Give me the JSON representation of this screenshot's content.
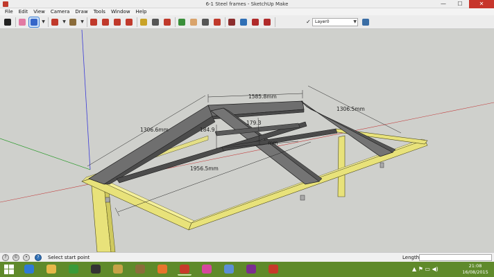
{
  "window": {
    "title": "6-1 Steel frames - SketchUp Make",
    "minimize": "—",
    "maximize": "☐",
    "close": "✕"
  },
  "menu": [
    "File",
    "Edit",
    "View",
    "Camera",
    "Draw",
    "Tools",
    "Window",
    "Help"
  ],
  "toolbar": {
    "layer_selected": "Layer0",
    "layer_check": "✓",
    "tools": [
      {
        "name": "select-tool-button",
        "icon": "arrow-pointer-icon",
        "color": "#222222"
      },
      {
        "name": "eraser-tool-button",
        "icon": "eraser-icon",
        "color": "#e27aa3"
      },
      {
        "name": "pencil-tool-button",
        "icon": "pencil-icon",
        "color": "#3566c9",
        "active": true
      },
      {
        "name": "pencil-dropdown-button",
        "icon": "chevron-down-icon",
        "color": "#333333"
      },
      {
        "name": "arc-tool-button",
        "icon": "arc-icon",
        "color": "#c0392b"
      },
      {
        "name": "arc-dropdown-button",
        "icon": "chevron-down-icon",
        "color": "#333333"
      },
      {
        "name": "paint-bucket-button",
        "icon": "paint-bucket-icon",
        "color": "#8a6b3a"
      },
      {
        "name": "paint-dropdown-button",
        "icon": "chevron-down-icon",
        "color": "#333333"
      },
      {
        "name": "push-pull-button",
        "icon": "push-pull-icon",
        "color": "#c0392b"
      },
      {
        "name": "move-tool-button",
        "icon": "move-icon",
        "color": "#c0392b"
      },
      {
        "name": "rotate-tool-button",
        "icon": "rotate-icon",
        "color": "#c0392b"
      },
      {
        "name": "scale-tool-button",
        "icon": "scale-icon",
        "color": "#c0392b"
      },
      {
        "name": "tape-measure-button",
        "icon": "tape-measure-icon",
        "color": "#c9a227"
      },
      {
        "name": "text-tool-button",
        "icon": "text-icon",
        "color": "#555555"
      },
      {
        "name": "axes-tool-button",
        "icon": "axes-icon",
        "color": "#c0392b"
      },
      {
        "name": "orbit-tool-button",
        "icon": "orbit-icon",
        "color": "#3a8f3a"
      },
      {
        "name": "pan-tool-button",
        "icon": "hand-icon",
        "color": "#d9a36b"
      },
      {
        "name": "zoom-tool-button",
        "icon": "magnifier-icon",
        "color": "#555555"
      },
      {
        "name": "zoom-extents-button",
        "icon": "zoom-extents-icon",
        "color": "#c0392b"
      },
      {
        "name": "warehouse-button",
        "icon": "warehouse-icon",
        "color": "#8b2d2d"
      },
      {
        "name": "extension-button",
        "icon": "extension-icon",
        "color": "#2f6fb5"
      },
      {
        "name": "share-model-button",
        "icon": "share-model-icon",
        "color": "#b02a2a"
      },
      {
        "name": "components-button",
        "icon": "components-icon",
        "color": "#b02a2a"
      },
      {
        "name": "layer-manager-button",
        "icon": "layers-icon",
        "color": "#3b6ea5"
      }
    ]
  },
  "dimensions": {
    "ridge": "1585.8mm",
    "left_rafter": "1306.6mm",
    "right_rafter": "1306.5mm",
    "span": "1956.5mm",
    "height_a": "184.9",
    "height_b": "179.3",
    "inner_span": "mm"
  },
  "status": {
    "hint": "Select start point",
    "length_label": "Length",
    "length_value": ""
  },
  "taskbar": {
    "clock_time": "21:08",
    "clock_date": "16/08/2015",
    "apps": [
      {
        "name": "taskbar-ie",
        "color": "#2f7ad6",
        "open": false
      },
      {
        "name": "taskbar-explorer",
        "color": "#e6b84a",
        "open": false
      },
      {
        "name": "taskbar-media",
        "color": "#3a9a3a",
        "open": false
      },
      {
        "name": "taskbar-camera",
        "color": "#333333",
        "open": false
      },
      {
        "name": "taskbar-app5",
        "color": "#c7a247",
        "open": false
      },
      {
        "name": "taskbar-app6",
        "color": "#8a6d3b",
        "open": false
      },
      {
        "name": "taskbar-firefox",
        "color": "#e8742c",
        "open": false
      },
      {
        "name": "taskbar-sketchup",
        "color": "#c73a2b",
        "open": true
      },
      {
        "name": "taskbar-itunes",
        "color": "#d6479e",
        "open": false
      },
      {
        "name": "taskbar-vlc",
        "color": "#5c8fd6",
        "open": false
      },
      {
        "name": "taskbar-onenote",
        "color": "#7b2d8f",
        "open": false
      },
      {
        "name": "taskbar-app12",
        "color": "#c73a2b",
        "open": false
      }
    ]
  }
}
